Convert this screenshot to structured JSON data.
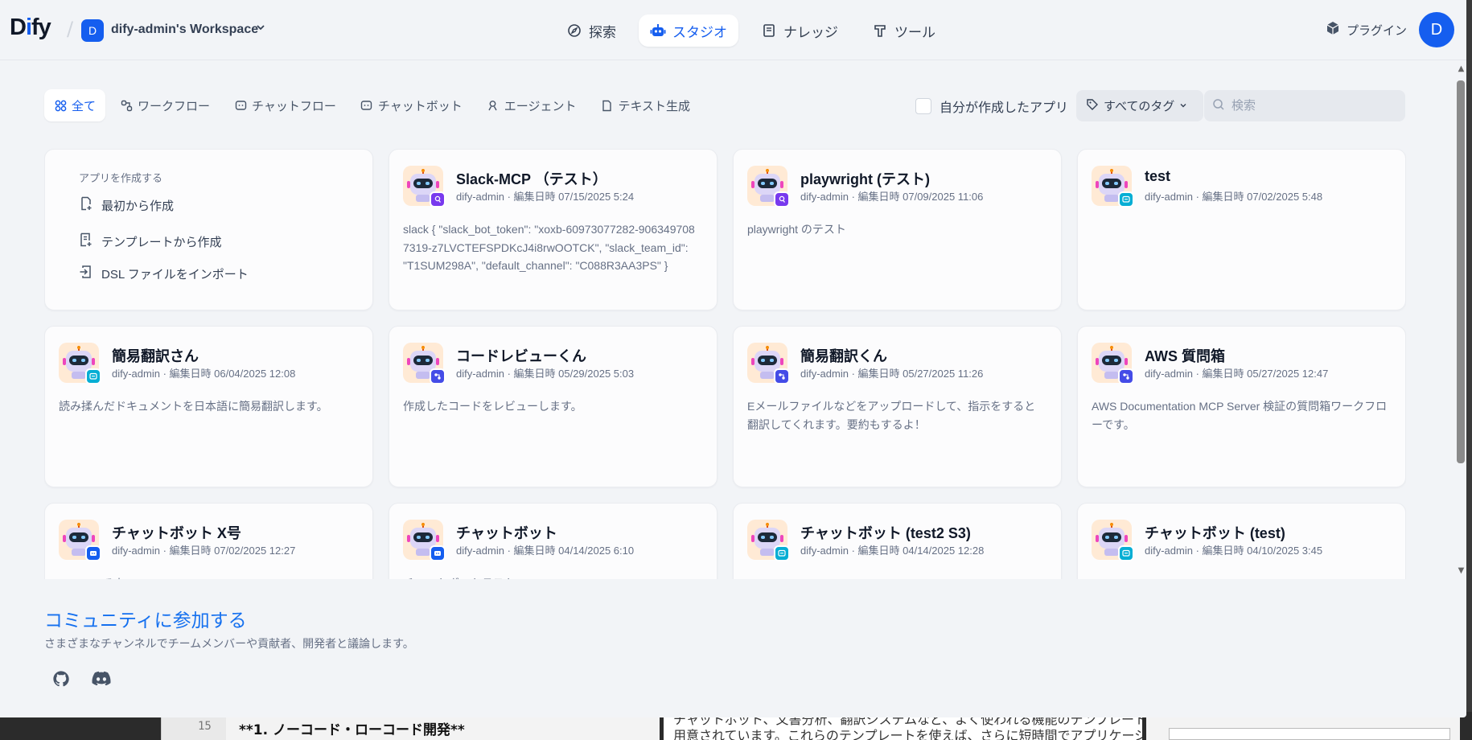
{
  "background_editor": {
    "line_number": "15",
    "code_line": "**1. ノーコード・ローコード開発**",
    "mid_line_1": "チャットボット、文書分析、翻訳システムなど、よく使われる機能のテンプレートが最初から",
    "mid_line_2": "用意されています。これらのテンプレートを使えば、さらに短時間でアプリケーションを"
  },
  "header": {
    "logo_d": "D",
    "logo_i": "i",
    "logo_fy": "fy",
    "separator": "/",
    "workspace_initial": "D",
    "workspace_name": "dify-admin's Workspace",
    "nav": [
      {
        "label": "探索",
        "icon": "compass-icon",
        "active": false
      },
      {
        "label": "スタジオ",
        "icon": "robot-icon",
        "active": true
      },
      {
        "label": "ナレッジ",
        "icon": "book-icon",
        "active": false
      },
      {
        "label": "ツール",
        "icon": "hammer-icon",
        "active": false
      }
    ],
    "plugin_label": "プラグイン",
    "user_initial": "D"
  },
  "filters": {
    "tabs": [
      {
        "label": "全て",
        "active": true
      },
      {
        "label": "ワークフロー",
        "active": false
      },
      {
        "label": "チャットフロー",
        "active": false
      },
      {
        "label": "チャットボット",
        "active": false
      },
      {
        "label": "エージェント",
        "active": false
      },
      {
        "label": "テキスト生成",
        "active": false
      }
    ],
    "mine_label": "自分が作成したアプリ",
    "tags_label": "すべてのタグ",
    "search_placeholder": "検索"
  },
  "create": {
    "heading": "アプリを作成する",
    "options": [
      "最初から作成",
      "テンプレートから作成",
      "DSL ファイルをインポート"
    ]
  },
  "apps": [
    {
      "title": "Slack-MCP （テスト）",
      "meta": "dify-admin · 編集日時 07/15/2025 5:24",
      "desc": "slack { \"slack_bot_token\": \"xoxb-60973077282-9063497087319-z7LVCTEFSPDKcJ4i8rwOOTCK\", \"slack_team_id\": \"T1SUM298A\", \"default_channel\": \"C088R3AA3PS\" }",
      "type": "agent"
    },
    {
      "title": "playwright (テスト)",
      "meta": "dify-admin · 編集日時 07/09/2025 11:06",
      "desc": "playwright のテスト",
      "type": "agent"
    },
    {
      "title": "test",
      "meta": "dify-admin · 編集日時 07/02/2025 5:48",
      "desc": "",
      "type": "chatflow"
    },
    {
      "title": "簡易翻訳さん",
      "meta": "dify-admin · 編集日時 06/04/2025 12:08",
      "desc": "読み揉んだドキュメントを日本語に簡易翻訳します。",
      "type": "chatflow"
    },
    {
      "title": "コードレビューくん",
      "meta": "dify-admin · 編集日時 05/29/2025 5:03",
      "desc": "作成したコードをレビューします。",
      "type": "workflow"
    },
    {
      "title": "簡易翻訳くん",
      "meta": "dify-admin · 編集日時 05/27/2025 11:26",
      "desc": "Eメールファイルなどをアップロードして、指示をすると翻訳してくれます。要約もするよ！",
      "type": "workflow"
    },
    {
      "title": "AWS 質問箱",
      "meta": "dify-admin · 編集日時 05/27/2025 12:47",
      "desc": "AWS Documentation MCP Server 検証の質問箱ワークフローです。",
      "type": "workflow"
    },
    {
      "title": "チャットボット X号",
      "meta": "dify-admin · 編集日時 07/02/2025 12:27",
      "desc": "Chatbot です",
      "type": "chatbot"
    },
    {
      "title": "チャットボット",
      "meta": "dify-admin · 編集日時 04/14/2025 6:10",
      "desc": "チャットボットテスト",
      "type": "chatbot"
    },
    {
      "title": "チャットボット (test2 S3)",
      "meta": "dify-admin · 編集日時 04/14/2025 12:28",
      "desc": "",
      "type": "chatflow"
    },
    {
      "title": "チャットボット (test)",
      "meta": "dify-admin · 編集日時 04/10/2025 3:45",
      "desc": "",
      "type": "chatflow"
    }
  ],
  "badge_colors": {
    "agent": "#7839ee",
    "chatflow": "#06aed4",
    "workflow": "#444ce7",
    "chatbot": "#155eef"
  },
  "community": {
    "title": "コミュニティに参加する",
    "desc": "さまざまなチャンネルでチームメンバーや貢献者、開発者と議論します。",
    "links": [
      "github-icon",
      "discord-icon"
    ]
  },
  "colors": {
    "accent": "#155eef",
    "background": "#f2f4f7",
    "card": "#fcfcfd"
  }
}
